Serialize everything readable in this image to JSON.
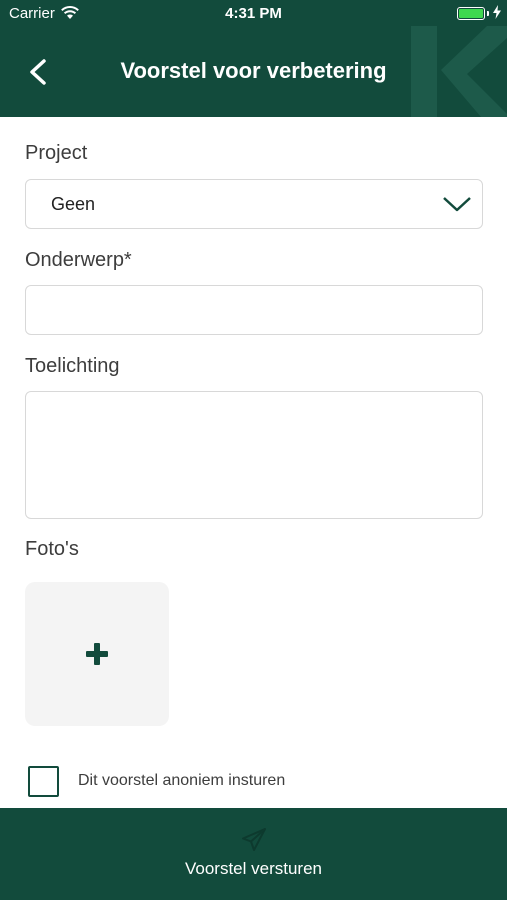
{
  "status_bar": {
    "carrier": "Carrier",
    "time": "4:31 PM"
  },
  "header": {
    "title": "Voorstel voor verbetering",
    "background_color": "#124b3c"
  },
  "form": {
    "project_label": "Project",
    "project_value": "Geen",
    "subject_label": "Onderwerp*",
    "subject_value": "",
    "explanation_label": "Toelichting",
    "explanation_value": "",
    "photos_label": "Foto's",
    "anonymous_label": "Dit voorstel anoniem insturen",
    "anonymous_checked": false
  },
  "footer": {
    "submit_label": "Voorstel versturen"
  },
  "icons": [
    "wifi-icon",
    "battery-icon",
    "charging-icon",
    "back-arrow-icon",
    "chevron-down-icon",
    "plus-icon",
    "paper-plane-icon",
    "brand-logo-watermark"
  ]
}
